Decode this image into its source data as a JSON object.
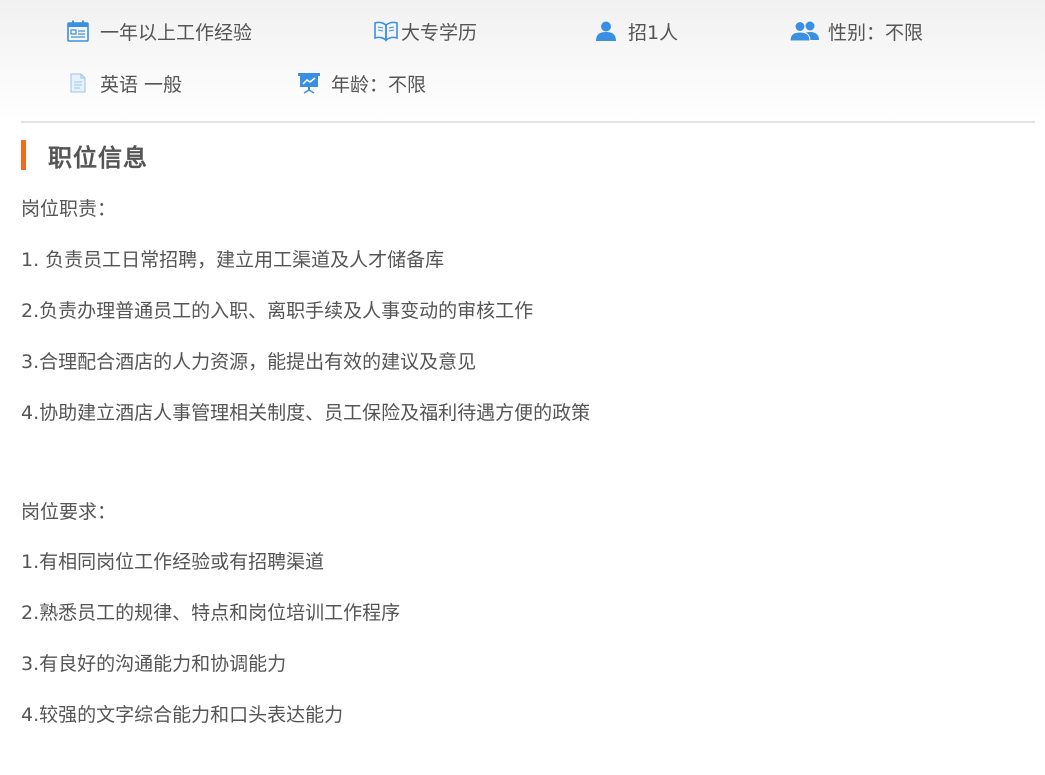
{
  "summary": {
    "experience": {
      "text": "一年以上工作经验",
      "icon": "calendar-icon"
    },
    "education": {
      "text": "大专学历",
      "icon": "open-book-icon"
    },
    "headcount": {
      "text": "招1人",
      "icon": "person-icon"
    },
    "gender": {
      "text": "性别：不限",
      "icon": "people-icon"
    },
    "language": {
      "text": "英语 一般",
      "icon": "document-icon"
    },
    "age": {
      "text": "年龄：不限",
      "icon": "presentation-board-icon"
    }
  },
  "section": {
    "title": "职位信息",
    "accent_color": "#f26b1d"
  },
  "duties": {
    "heading": "岗位职责：",
    "items": [
      "1. 负责员工日常招聘，建立用工渠道及人才储备库",
      "2.负责办理普通员工的入职、离职手续及人事变动的审核工作",
      "3.合理配合酒店的人力资源，能提出有效的建议及意见",
      "4.协助建立酒店人事管理相关制度、员工保险及福利待遇方便的政策"
    ]
  },
  "requirements": {
    "heading": "岗位要求：",
    "items": [
      "1.有相同岗位工作经验或有招聘渠道",
      "2.熟悉员工的规律、特点和岗位培训工作程序",
      "3.有良好的沟通能力和协调能力",
      "4.较强的文字综合能力和口头表达能力"
    ]
  },
  "colors": {
    "icon_blue": "#3b8fe3",
    "text": "#555555"
  }
}
